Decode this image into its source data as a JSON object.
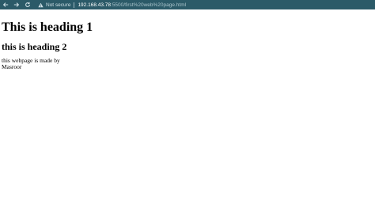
{
  "browser": {
    "security_label": "Not secure",
    "url_host": "192.168.43.78",
    "url_path": ":5500/first%20web%20page.html",
    "toolbar_color": "#2b5a68"
  },
  "content": {
    "heading1": "This is heading 1",
    "heading2": "this is heading 2",
    "paragraph_line1": "this webpage is made by",
    "paragraph_line2": "Masroor"
  }
}
